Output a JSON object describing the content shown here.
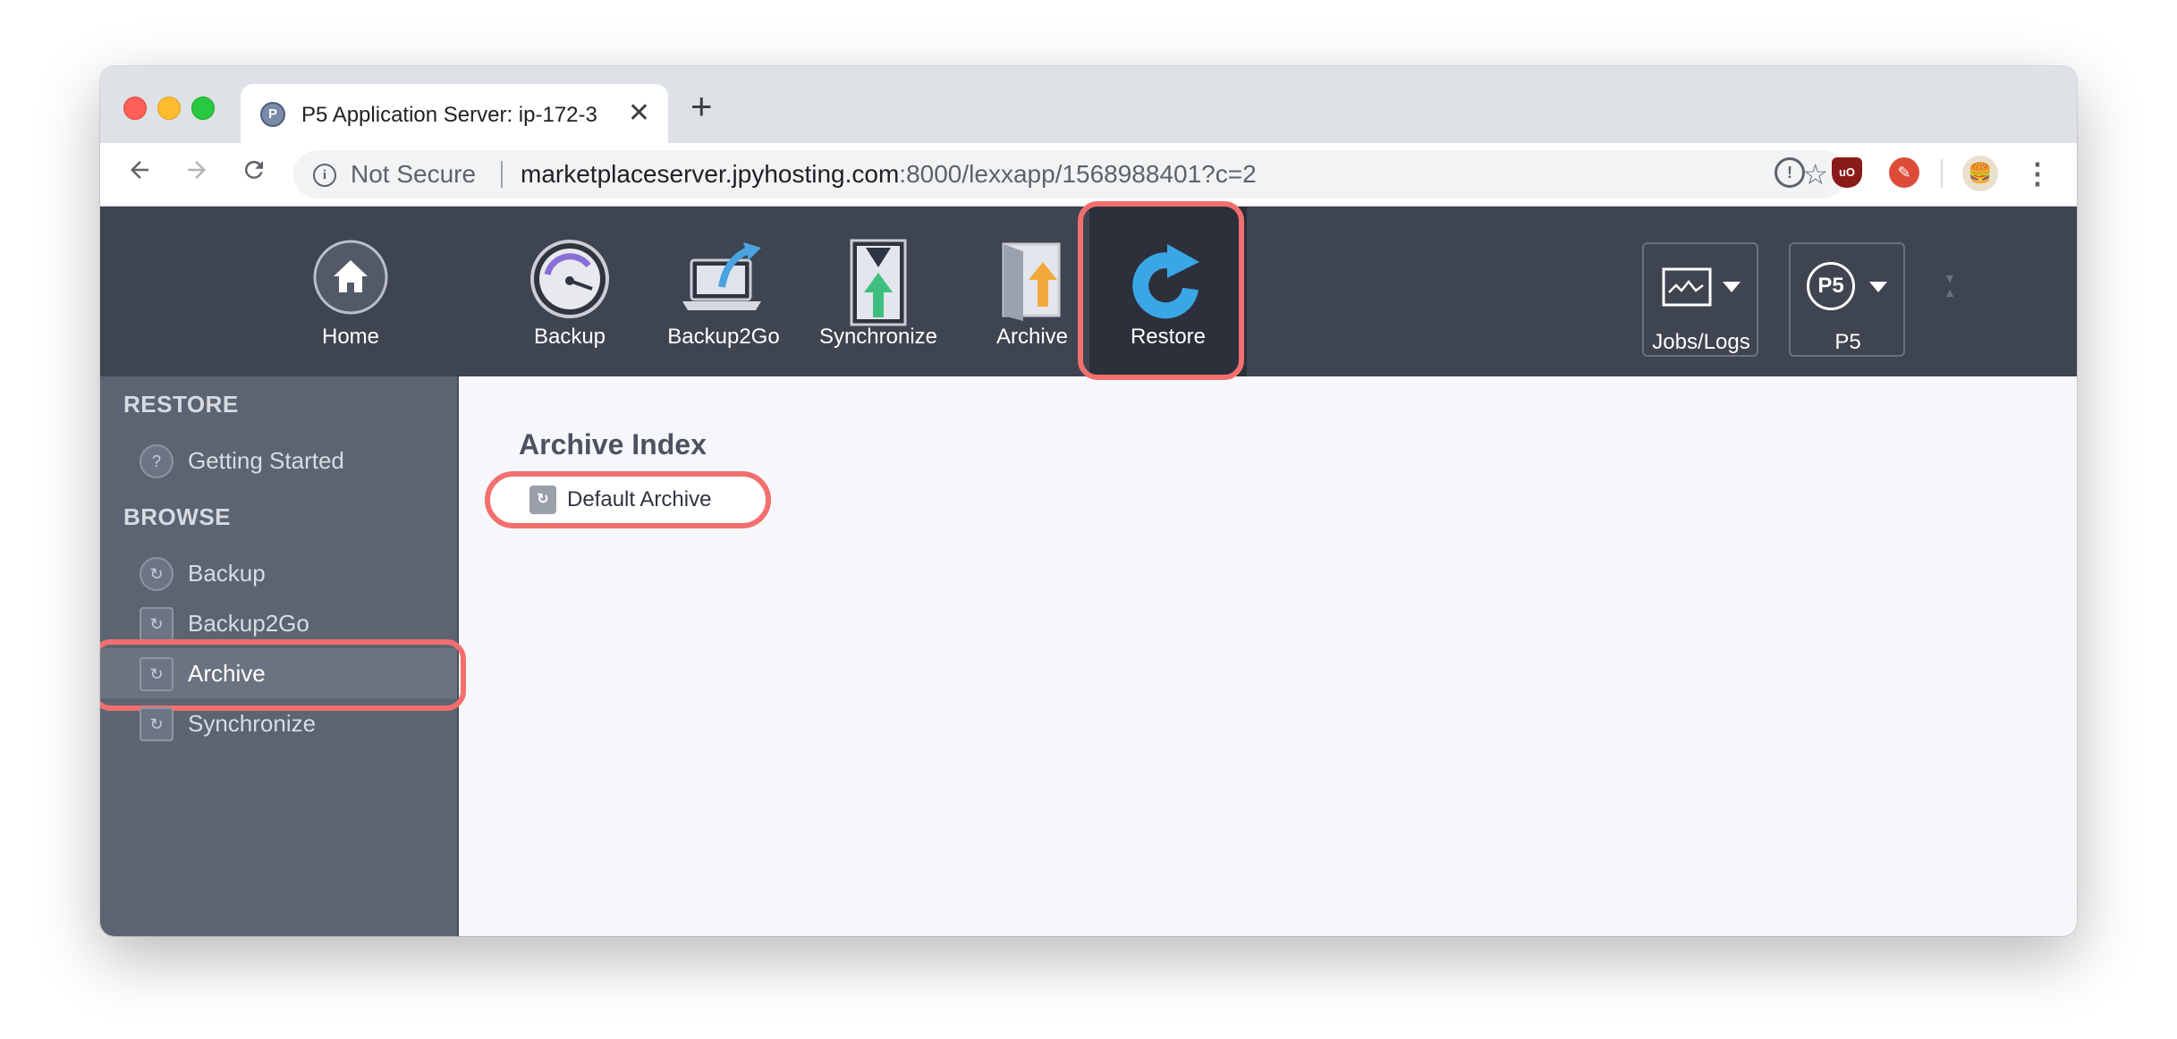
{
  "browser": {
    "tab_title": "P5 Application Server: ip-172-3",
    "tab_favicon": "P",
    "tab_close": "✕",
    "new_tab": "+",
    "security_label": "Not Secure",
    "url_host": "marketplaceserver.jpyhosting.com",
    "url_rest": ":8000/lexxapp/1568988401?c=2",
    "nav_icons": [
      "back-arrow-icon",
      "forward-arrow-icon",
      "reload-icon"
    ],
    "extension_icons": [
      "1password-icon",
      "ublock-origin-icon",
      "extension-icon",
      "profile-avatar-icon"
    ]
  },
  "app_nav": {
    "items": [
      {
        "label": "Home",
        "icon": "home-icon"
      },
      {
        "label": "Backup",
        "icon": "backup-gauge-icon"
      },
      {
        "label": "Backup2Go",
        "icon": "laptop-upload-icon"
      },
      {
        "label": "Synchronize",
        "icon": "synchronize-icon"
      },
      {
        "label": "Archive",
        "icon": "archive-vault-icon"
      },
      {
        "label": "Restore",
        "icon": "restore-arrow-icon",
        "active": true
      }
    ],
    "jobs_logs_label": "Jobs/Logs",
    "p5_label": "P5",
    "p5_logo_text": "P5"
  },
  "sidebar": {
    "restore_heading": "RESTORE",
    "getting_started": "Getting Started",
    "browse_heading": "BROWSE",
    "browse_items": [
      {
        "label": "Backup",
        "icon": "backup-restore-icon"
      },
      {
        "label": "Backup2Go",
        "icon": "backup2go-restore-icon"
      },
      {
        "label": "Archive",
        "icon": "archive-restore-icon",
        "active": true
      },
      {
        "label": "Synchronize",
        "icon": "synchronize-restore-icon"
      }
    ]
  },
  "main": {
    "title": "Archive Index",
    "archive_entry": "Default Archive"
  },
  "colors": {
    "header_bg": "#3e4450",
    "active_nav_bg": "#2b303a",
    "sidebar_bg": "#5c6472",
    "highlight": "#f36f6f",
    "content_bg": "#f6f7fb"
  }
}
